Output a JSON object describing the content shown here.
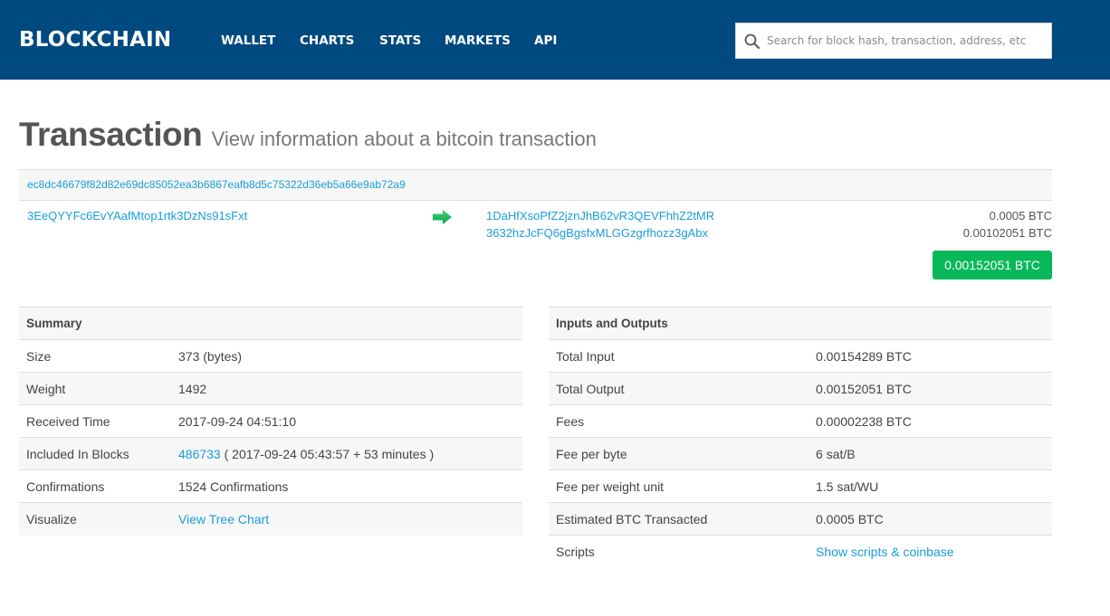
{
  "header": {
    "brand": "BLOCKCHAIN",
    "brand_color": "#004a7f",
    "nav": [
      {
        "label": "WALLET"
      },
      {
        "label": "CHARTS"
      },
      {
        "label": "STATS"
      },
      {
        "label": "MARKETS"
      },
      {
        "label": "API"
      }
    ],
    "search": {
      "placeholder": "Search for block hash, transaction, address, etc",
      "value": "",
      "icon": "search-icon"
    }
  },
  "page": {
    "title": "Transaction",
    "subtitle": "View information about a bitcoin transaction"
  },
  "transaction": {
    "hash": "ec8dc46679f82d82e69dc85052ea3b6867eafb8d5c75322d36eb5a66e9ab72a9",
    "inputs": [
      {
        "address": "3EeQYYFc6EvYAafMtop1rtk3DzNs91sFxt"
      }
    ],
    "arrow_icon": "arrow-right-icon",
    "outputs": [
      {
        "address": "1DaHfXsoPfZ2jznJhB62vR3QEVFhhZ2tMR",
        "amount": "0.0005 BTC"
      },
      {
        "address": "3632hzJcFQ6gBgsfxMLGGzgrfhozz3gAbx",
        "amount": "0.00102051 BTC"
      }
    ],
    "total": "0.00152051 BTC",
    "total_color": "#08b85a"
  },
  "summary": {
    "heading": "Summary",
    "rows": [
      {
        "label": "Size",
        "value": "373 (bytes)"
      },
      {
        "label": "Weight",
        "value": "1492"
      },
      {
        "label": "Received Time",
        "value": "2017-09-24 04:51:10"
      },
      {
        "label": "Included In Blocks",
        "block_link": "486733",
        "value": " ( 2017-09-24 05:43:57 + 53 minutes )"
      },
      {
        "label": "Confirmations",
        "value": "1524 Confirmations"
      },
      {
        "label": "Visualize",
        "link": "View Tree Chart"
      }
    ]
  },
  "inputs_outputs": {
    "heading": "Inputs and Outputs",
    "rows": [
      {
        "label": "Total Input",
        "value": "0.00154289 BTC"
      },
      {
        "label": "Total Output",
        "value": "0.00152051 BTC"
      },
      {
        "label": "Fees",
        "value": "0.00002238 BTC"
      },
      {
        "label": "Fee per byte",
        "value": "6 sat/B"
      },
      {
        "label": "Fee per weight unit",
        "value": "1.5 sat/WU"
      },
      {
        "label": "Estimated BTC Transacted",
        "value": "0.0005 BTC"
      },
      {
        "label": "Scripts",
        "link": "Show scripts & coinbase"
      }
    ]
  },
  "colors": {
    "link": "#1a9ed9",
    "header_bg": "#004a7f",
    "success": "#08b85a"
  }
}
